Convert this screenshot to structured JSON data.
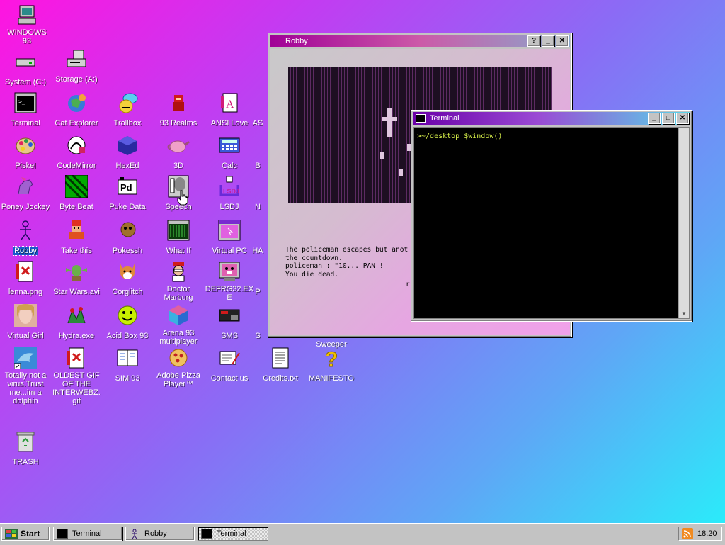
{
  "desktop": {
    "icons": [
      {
        "label": "WINDOWS 93",
        "icon": "computer-icon"
      },
      {
        "label": "System (C:)",
        "icon": "drive-icon"
      },
      {
        "label": "Storage (A:)",
        "icon": "floppy-drive-icon"
      },
      {
        "label": "Terminal",
        "icon": "terminal-icon"
      },
      {
        "label": "Cat Explorer",
        "icon": "cat-globe-icon"
      },
      {
        "label": "Trollbox",
        "icon": "trollbox-icon"
      },
      {
        "label": "93 Realms",
        "icon": "realms-icon"
      },
      {
        "label": "ANSI Love",
        "icon": "ansi-icon"
      },
      {
        "label": "AS",
        "icon": "partial-icon"
      },
      {
        "label": "Piskel",
        "icon": "palette-icon"
      },
      {
        "label": "CodeMirror",
        "icon": "codemirror-icon"
      },
      {
        "label": "HexEd",
        "icon": "cube-icon"
      },
      {
        "label": "3D",
        "icon": "teapot-icon"
      },
      {
        "label": "Calc",
        "icon": "calculator-icon"
      },
      {
        "label": "B",
        "icon": "partial-icon"
      },
      {
        "label": "Poney Jockey",
        "icon": "pony-icon"
      },
      {
        "label": "Byte Beat",
        "icon": "bytebeat-icon"
      },
      {
        "label": "Puke Data",
        "icon": "puredata-icon"
      },
      {
        "label": "Speech",
        "icon": "speech-icon"
      },
      {
        "label": "LSDJ",
        "icon": "lsdj-icon"
      },
      {
        "label": "N",
        "icon": "partial-icon"
      },
      {
        "label": "Robby",
        "icon": "stickman-icon",
        "selected": true
      },
      {
        "label": "Take this",
        "icon": "take-this-icon"
      },
      {
        "label": "Pokessh",
        "icon": "pokessh-icon"
      },
      {
        "label": "What If",
        "icon": "what-if-icon"
      },
      {
        "label": "Virtual PC",
        "icon": "virtual-pc-icon"
      },
      {
        "label": "HA",
        "icon": "partial-icon"
      },
      {
        "label": "lenna.png",
        "icon": "image-file-icon"
      },
      {
        "label": "Star Wars.avi",
        "icon": "yoda-icon"
      },
      {
        "label": "Corglitch",
        "icon": "corgi-icon"
      },
      {
        "label": "Doctor Marburg",
        "icon": "doctor-icon"
      },
      {
        "label": "DEFRG32.EXE",
        "icon": "defrag-icon"
      },
      {
        "label": "P",
        "icon": "partial-icon"
      },
      {
        "label": "Virtual Girl",
        "icon": "virtual-girl-icon"
      },
      {
        "label": "Hydra.exe",
        "icon": "hydra-icon"
      },
      {
        "label": "Acid Box 93",
        "icon": "smiley-icon"
      },
      {
        "label": "Arena 93 multiplayer",
        "icon": "arena-cube-icon"
      },
      {
        "label": "SMS",
        "icon": "sms-icon"
      },
      {
        "label": "S",
        "icon": "partial-icon"
      },
      {
        "label": "Sweeper",
        "icon": "sweeper-icon"
      },
      {
        "label": "Totally not a virus.Trust me...im a dolphin",
        "icon": "dolphin-icon"
      },
      {
        "label": "OLDEST GIF OF THE INTERWEBZ.gif",
        "icon": "gif-file-icon"
      },
      {
        "label": "SIM 93",
        "icon": "sim-book-icon"
      },
      {
        "label": "Adobe Pizza Player™",
        "icon": "pizza-icon"
      },
      {
        "label": "Contact us",
        "icon": "contact-icon"
      },
      {
        "label": "Credits.txt",
        "icon": "text-file-icon"
      },
      {
        "label": "MANIFESTO",
        "icon": "question-icon"
      },
      {
        "label": "TRASH",
        "icon": "trash-icon"
      }
    ]
  },
  "robby_window": {
    "title": "Robby",
    "text": "The policeman escapes but anot\nthe countdown.\npoliceman : \"10... PAN !\nYou die dead.",
    "trailing": "r"
  },
  "terminal_window": {
    "title": "Terminal",
    "prompt": ">~/desktop $window()"
  },
  "taskbar": {
    "start_label": "Start",
    "buttons": [
      "Terminal",
      "Robby",
      "Terminal"
    ],
    "clock": "18:20"
  },
  "colors": {
    "bg_start": "#ff14e0",
    "bg_end": "#27f0fa",
    "terminal_text": "#d8f04a"
  }
}
